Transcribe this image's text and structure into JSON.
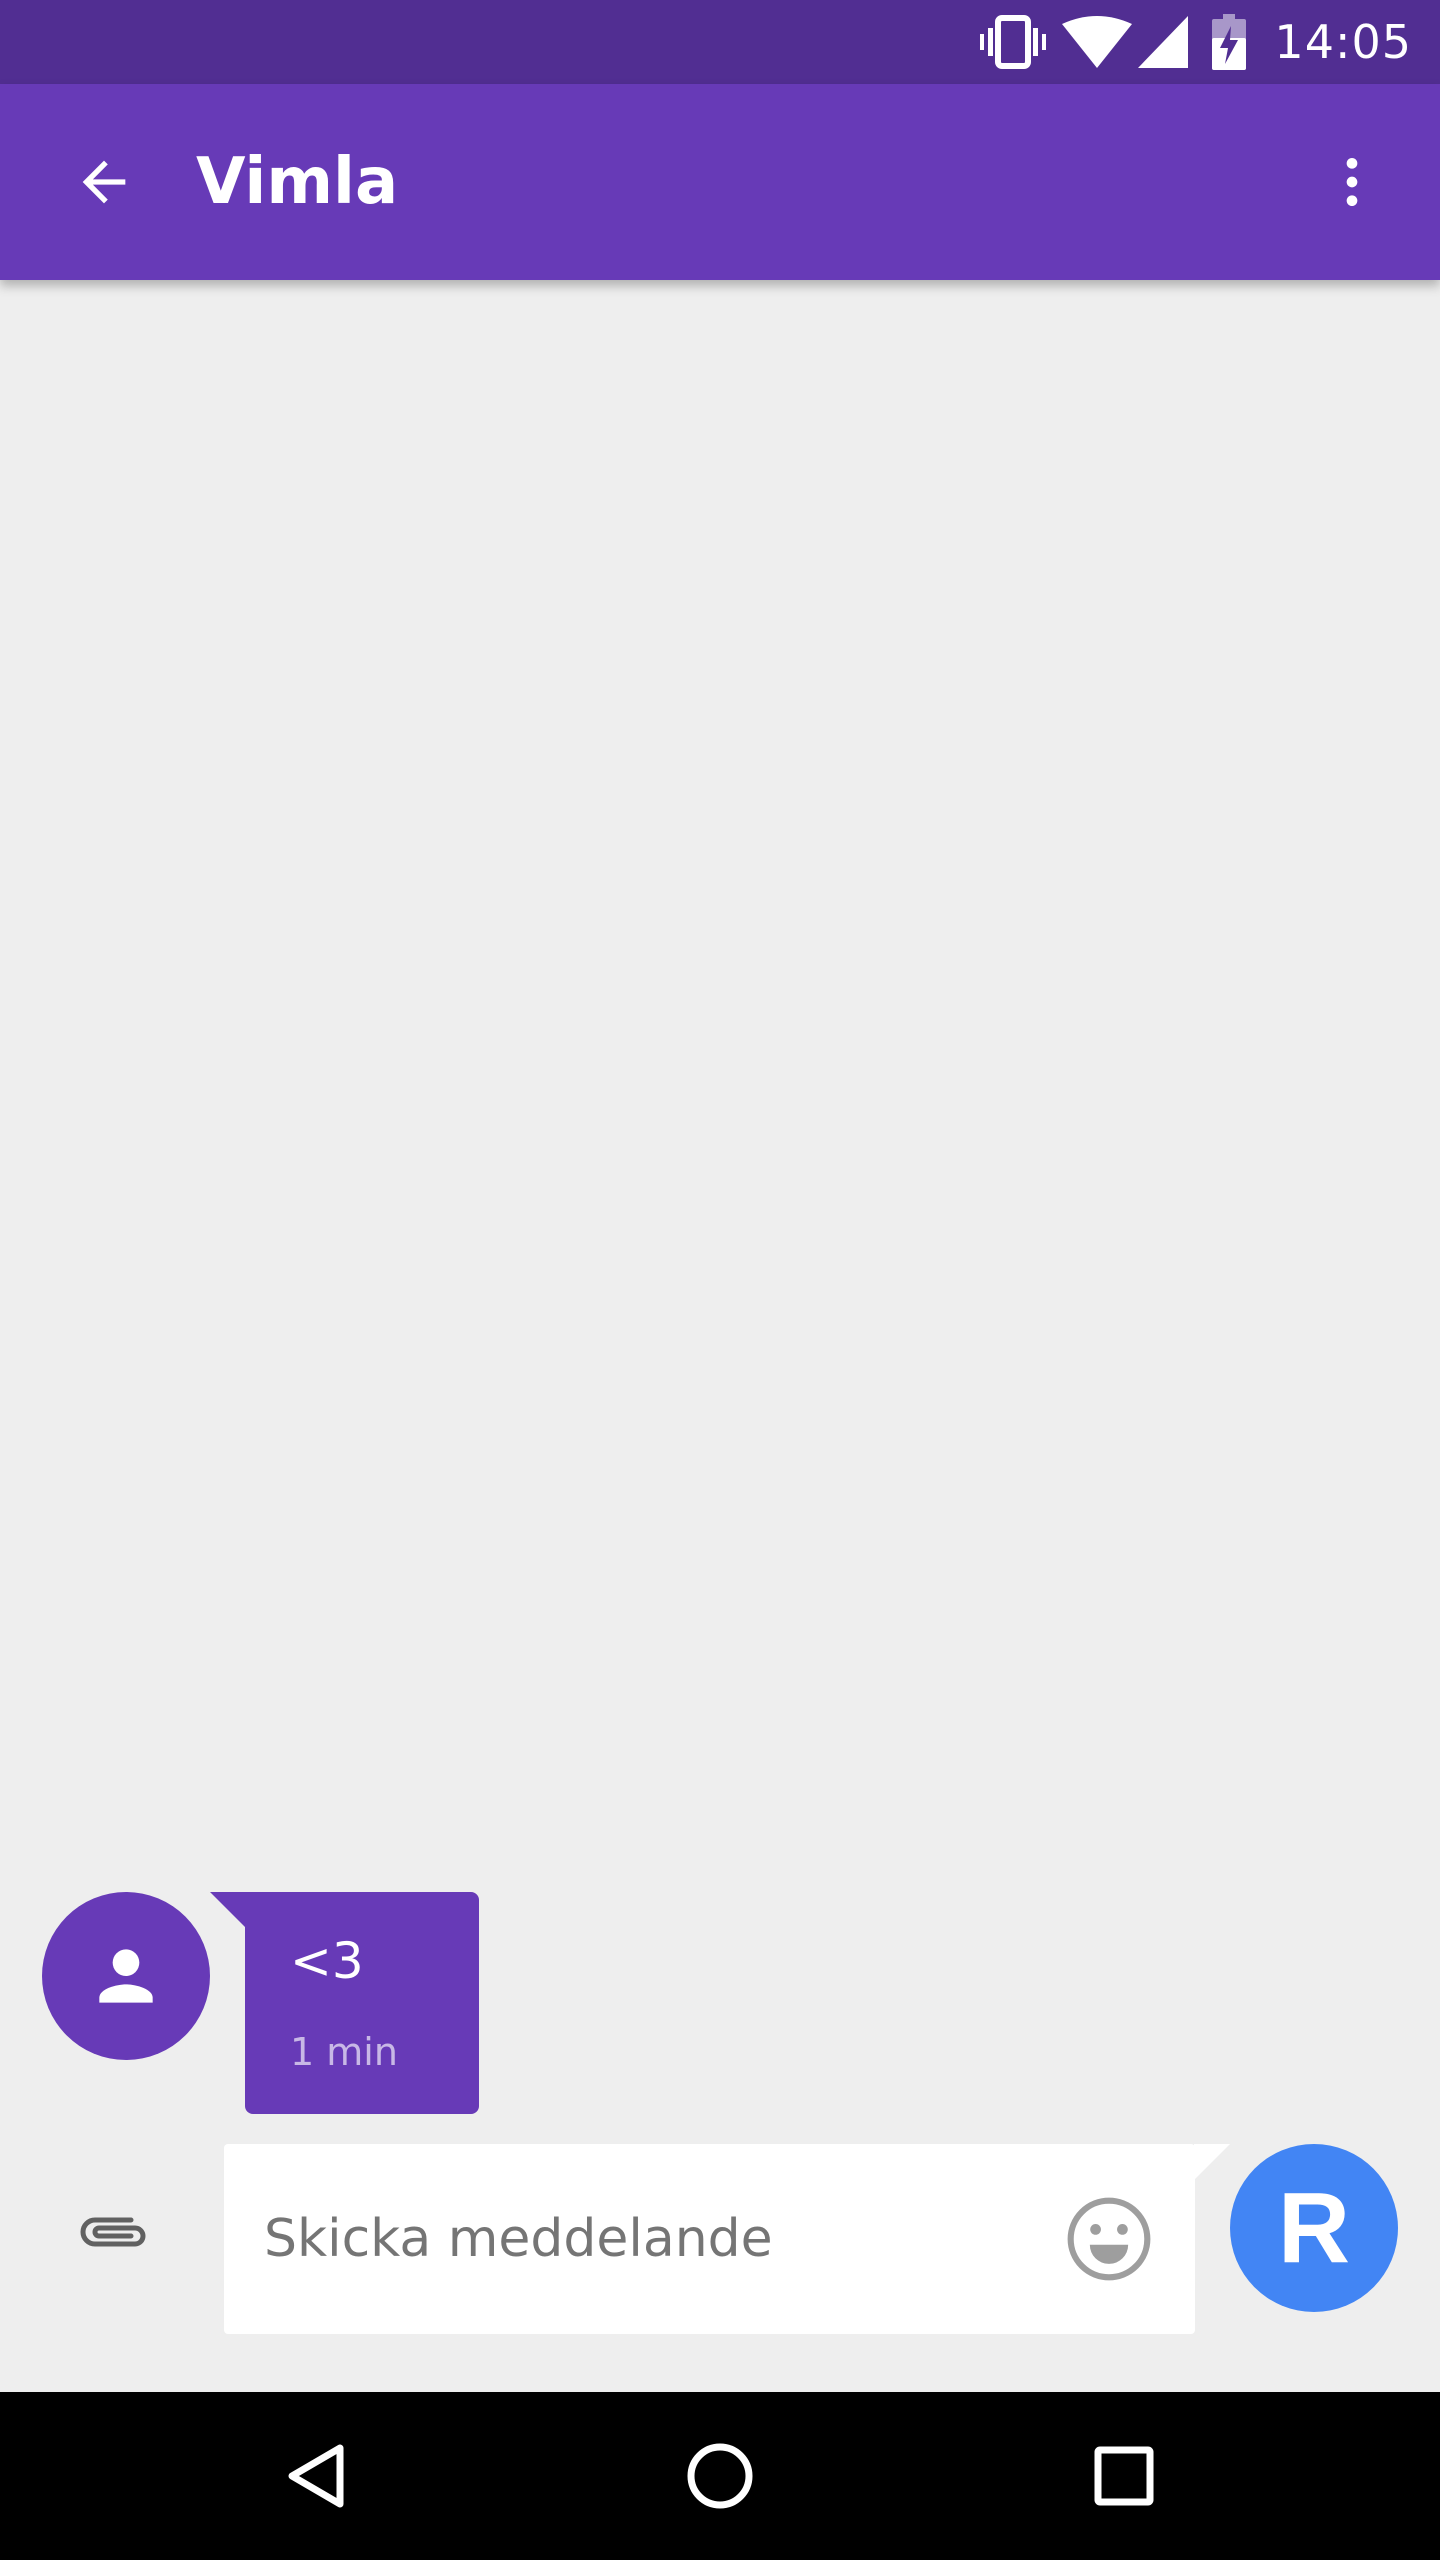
{
  "status_bar": {
    "time": "14:05",
    "icons": [
      "vibrate-icon",
      "wifi-icon",
      "cellular-signal-icon",
      "battery-charging-icon"
    ],
    "background": "#512e92"
  },
  "app_bar": {
    "title": "Vimla",
    "background": "#673ab7",
    "back_icon": "arrow-back-icon",
    "menu_icon": "more-vert-icon"
  },
  "conversation": {
    "messages": [
      {
        "sender_avatar_icon": "person-icon",
        "text": "<3",
        "time": "1 min",
        "bubble_color": "#673ab7"
      }
    ]
  },
  "compose": {
    "placeholder": "Skicka meddelande",
    "value": "",
    "attach_icon": "paperclip-icon",
    "emoji_icon": "emoji-icon",
    "self_avatar_letter": "R",
    "self_avatar_color": "#4285f4"
  },
  "nav_bar": {
    "icons": [
      "nav-back-icon",
      "nav-home-icon",
      "nav-recents-icon"
    ]
  }
}
